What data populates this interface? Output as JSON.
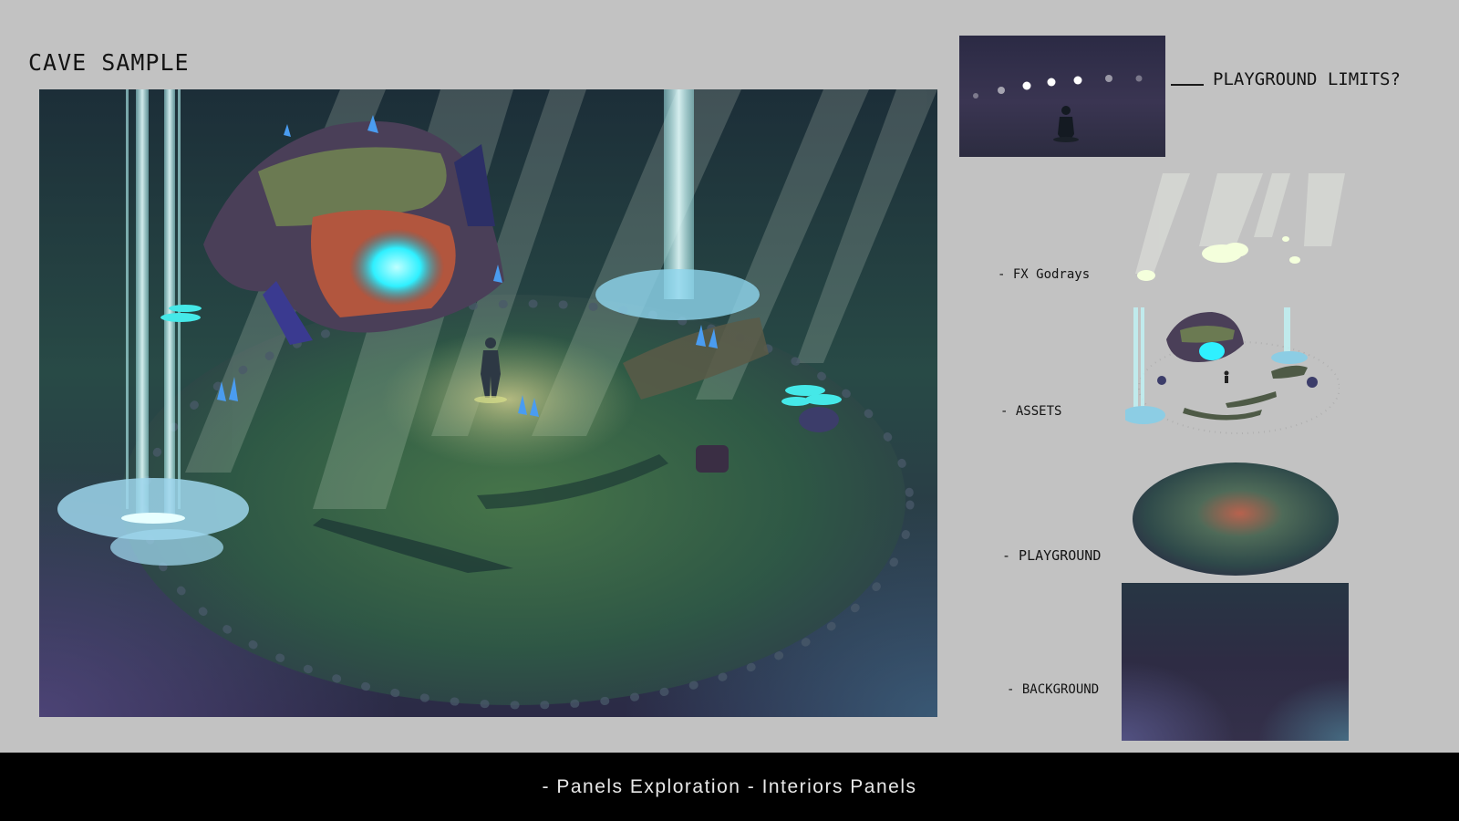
{
  "title": "CAVE SAMPLE",
  "annotations": {
    "limits": "PLAYGROUND LIMITS?",
    "fx": "- FX Godrays",
    "assets": "- ASSETS",
    "playground": "- PLAYGROUND",
    "background": "- BACKGROUND"
  },
  "footer": "- Panels Exploration - Interiors Panels",
  "colors": {
    "page": "#c2c2c2",
    "cave_dark": "#2e2a44",
    "floor_green": "#3b6a46",
    "glow_cyan": "#2ff0ff",
    "water": "#8fd6ee",
    "footer": "#000000"
  }
}
